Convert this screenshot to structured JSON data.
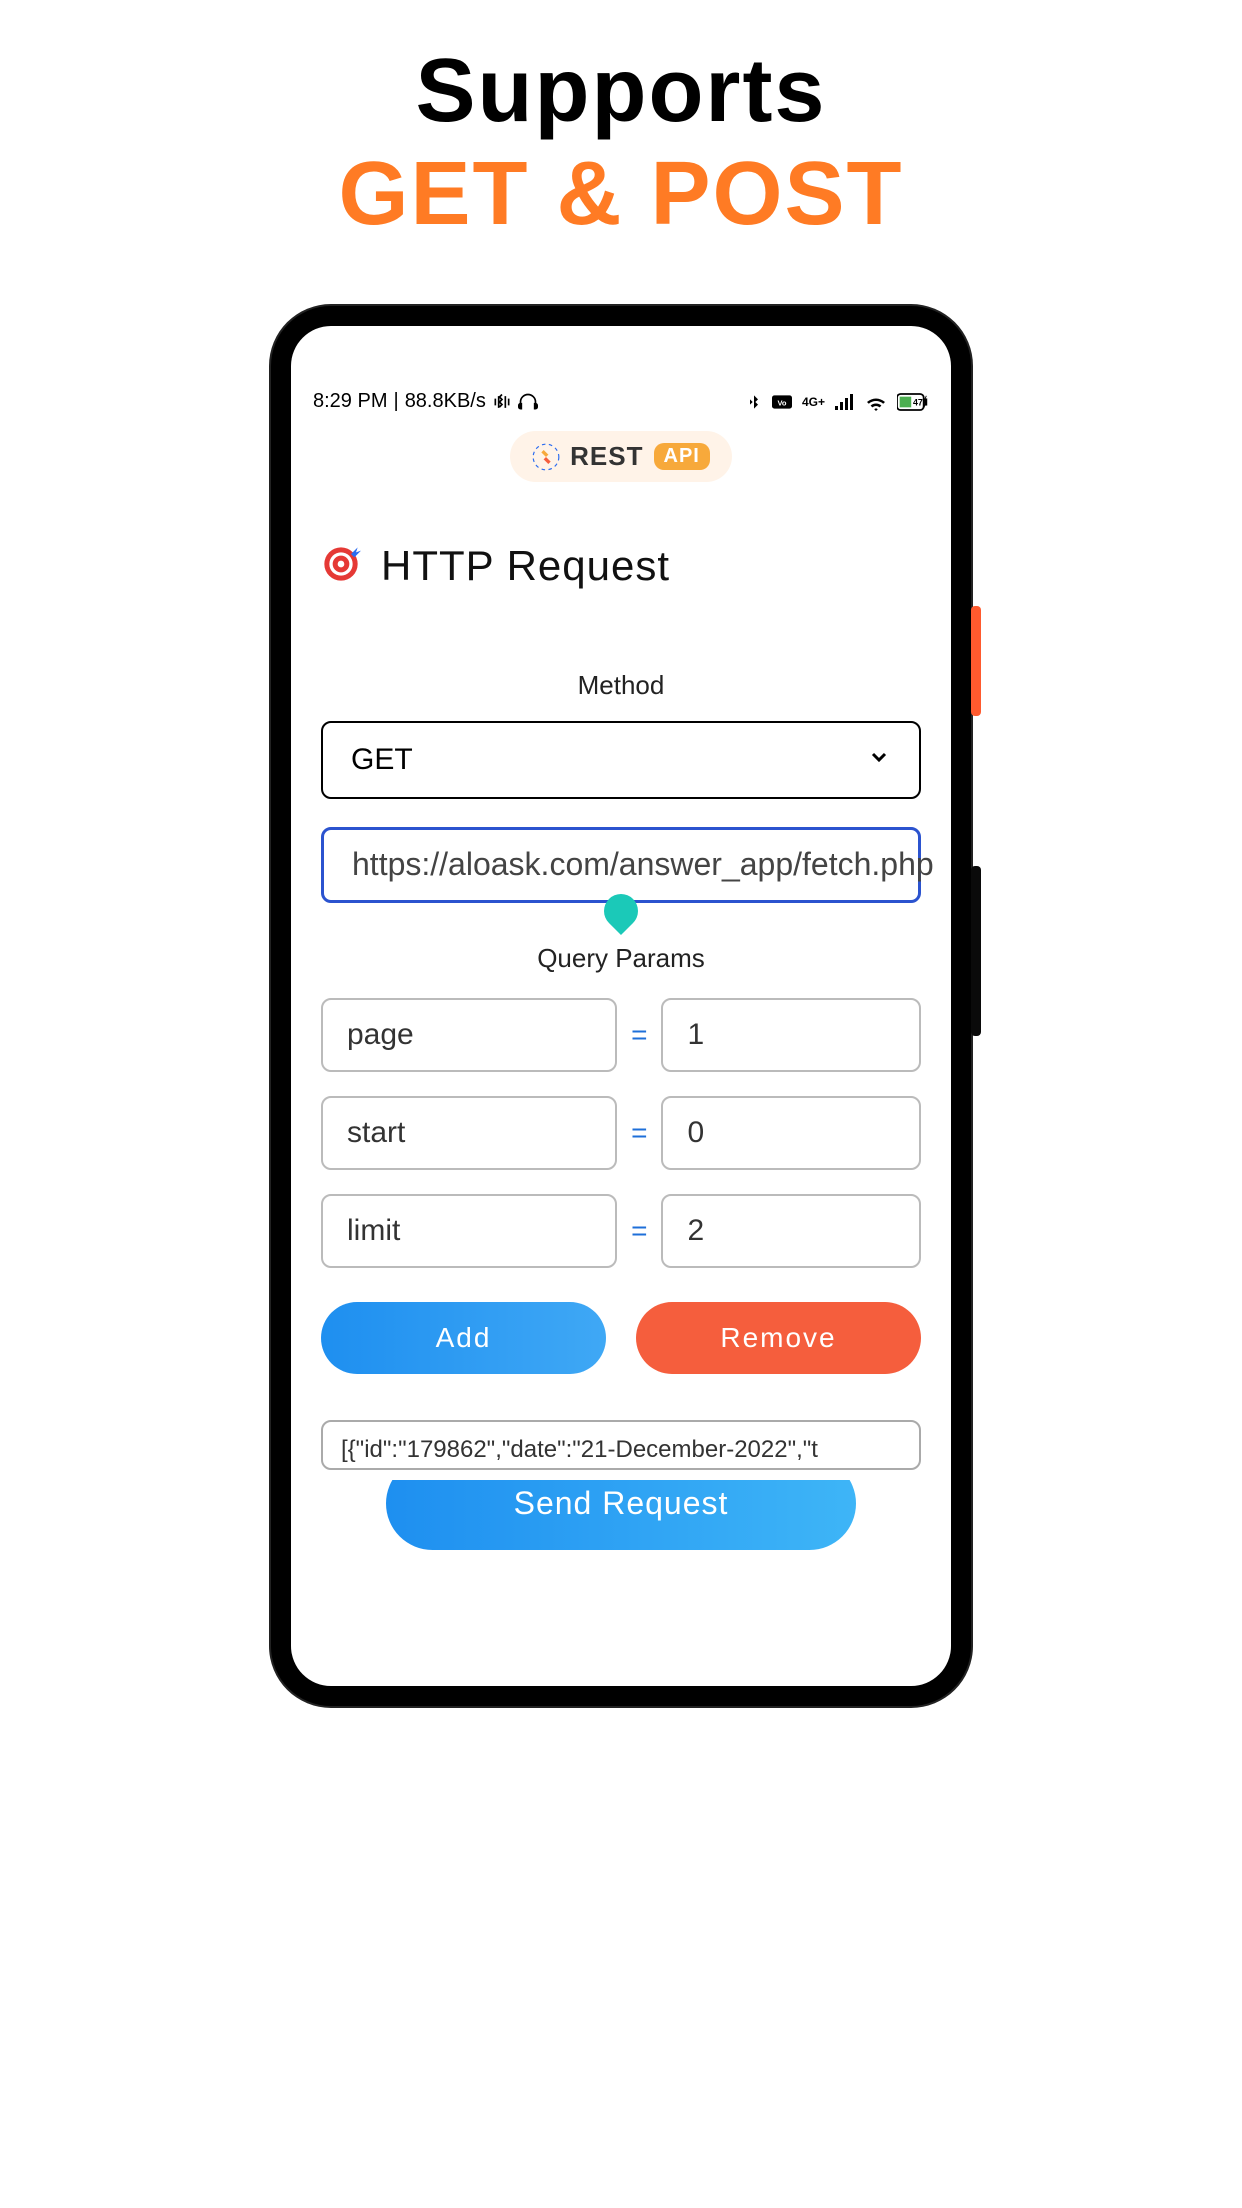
{
  "promo": {
    "line1": "Supports",
    "line2": "GET & POST"
  },
  "statusbar": {
    "time": "8:29 PM",
    "speed": "88.8KB/s"
  },
  "app_chip": {
    "brand": "REST",
    "badge": "API"
  },
  "page": {
    "title": "HTTP Request"
  },
  "method": {
    "label": "Method",
    "selected": "GET"
  },
  "url": {
    "value": "https://aloask.com/answer_app/fetch.php"
  },
  "query": {
    "label": "Query Params",
    "params": [
      {
        "key": "page",
        "value": "1"
      },
      {
        "key": "start",
        "value": "0"
      },
      {
        "key": "limit",
        "value": "2"
      }
    ]
  },
  "buttons": {
    "add": "Add",
    "remove": "Remove",
    "send": "Send Request"
  },
  "response": {
    "preview": "[{\"id\":\"179862\",\"date\":\"21-December-2022\",\"t"
  }
}
